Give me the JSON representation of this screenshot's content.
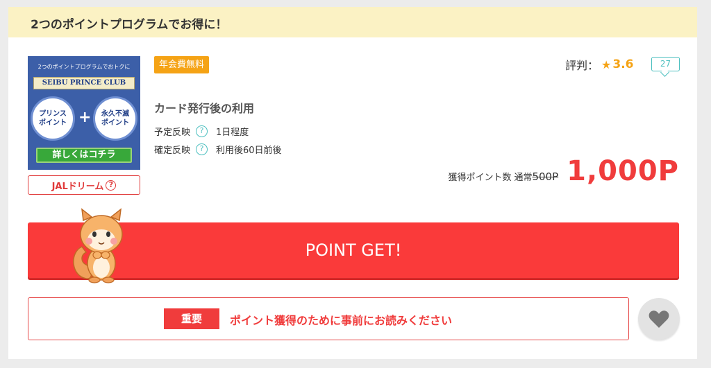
{
  "banner": {
    "title": "2つのポイントプログラムでお得に！"
  },
  "thumbnail": {
    "top_text": "2つのポイントプログラムでおトクに",
    "brand": "SEIBU PRINCE CLUB",
    "circle_left": "プリンス ポイント",
    "plus": "+",
    "circle_right": "永久不滅 ポイント",
    "button": "詳しくはコチラ"
  },
  "jal": {
    "label": "JALドリーム",
    "help": "?"
  },
  "badge": {
    "label": "年会費無料",
    "color": "#f5a315"
  },
  "rating": {
    "label": "評判：",
    "star": "★",
    "value": "3.6",
    "reviews": "27"
  },
  "condition": "カード発行後の利用",
  "schedule": [
    {
      "label": "予定反映",
      "help": "?",
      "value": "1日程度"
    },
    {
      "label": "確定反映",
      "help": "?",
      "value": "利用後60日前後"
    }
  ],
  "points": {
    "label": "獲得ポイント数",
    "normal_label": "通常",
    "old": "500P",
    "value": "1,000P",
    "color": "#f03c3c"
  },
  "cta": {
    "label": "POINT GET!",
    "color": "#fa3a3a"
  },
  "notice": {
    "tag": "重要",
    "text": "ポイント獲得のために事前にお読みください"
  },
  "icons": {
    "mascot": "squirrel-mascot-icon",
    "favorite": "heart-icon"
  }
}
